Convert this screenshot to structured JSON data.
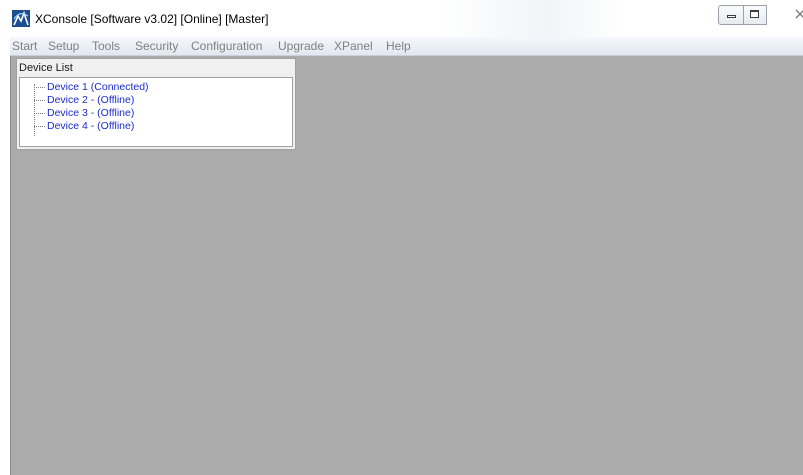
{
  "window": {
    "title": "XConsole [Software v3.02] [Online] [Master]",
    "icon": "xconsole-app-icon",
    "controls": [
      "minimize-icon",
      "maximize-icon",
      "close-icon"
    ]
  },
  "menu": {
    "items": [
      "Start",
      "Setup",
      "Tools",
      "Security",
      "Configuration",
      "Upgrade",
      "XPanel",
      "Help"
    ]
  },
  "device_list": {
    "title": "Device List",
    "devices": [
      "Device 1 (Connected)",
      "Device 2 -  (Offline)",
      "Device 3 -  (Offline)",
      "Device 4 -  (Offline)"
    ]
  },
  "colors": {
    "client_background": "#ababab",
    "tree_text": "#1a2ccc",
    "menu_text": "#808080"
  }
}
